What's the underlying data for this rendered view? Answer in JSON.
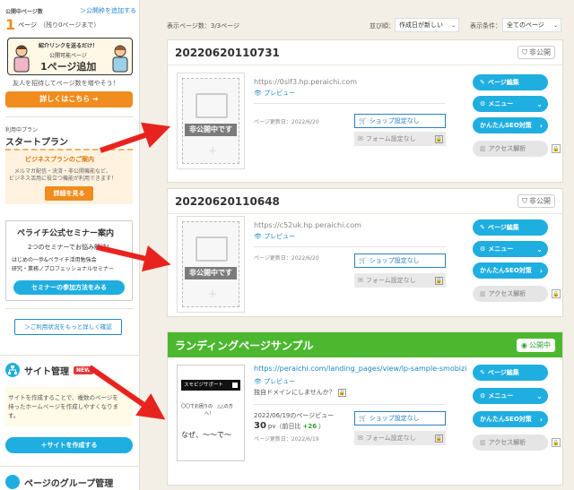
{
  "sidebar": {
    "public_pages_label": "公開中ページ数",
    "add_pages_link": "＞公開枠を追加する",
    "page_count": "1",
    "page_count_suffix": "ページ",
    "page_count_remaining": "（残り0ページまで）",
    "promo_top": "紹介リンクを送るだけ！",
    "promo_mid": "公開可能ページ",
    "promo_main": "1ページ追加",
    "promo_desc": "友人を招待してページ数を増やそう！",
    "promo_button": "詳しくはこちら",
    "plan_label": "利用中プラン",
    "plan_name": "スタートプラン",
    "business_title": "ビジネスプランのご案内",
    "business_desc1": "メルマガ配信・決済・非公開機能など、",
    "business_desc2": "ビジネス活用に役立つ機能が利用できます！",
    "business_button": "詳細を見る",
    "seminar_title": "ペライチ公式セミナー案内",
    "seminar_desc1": "2つのセミナーでお悩み解決!",
    "seminar_desc2": "はじめの一歩&ペライチ活用勉強会",
    "seminar_desc3": "研究・業務ノプロフェッショナルセミナー",
    "seminar_button": "セミナーの参加方法をみる",
    "usage_link": "＞ご利用状況をもっと詳しく確認",
    "site_title": "サイト管理",
    "site_badge": "NEW",
    "site_desc1": "サイトを作成することで、複数のページを",
    "site_desc2": "持ったホームページを作成しやすくなりま",
    "site_desc3": "す。",
    "site_button": "＋サイトを作成する",
    "group_title": "ページのグループ管理"
  },
  "toolbar": {
    "count_text": "表示ページ数：3/3ページ",
    "sort_label": "並び順：",
    "sort_value": "作成日が新しい",
    "filter_label": "表示条件：",
    "filter_value": "全てのページ"
  },
  "cards": [
    {
      "title": "20220620110731",
      "status": "非公開",
      "url": "https://0slf3.hp.peraichi.com",
      "preview": "プレビュー",
      "updated": "ページ更新日：2022/6/20",
      "thumb_label": "非公開中です"
    },
    {
      "title": "20220620110648",
      "status": "非公開",
      "url": "https://c52uk.hp.peraichi.com",
      "preview": "プレビュー",
      "updated": "ページ更新日：2022/6/20",
      "thumb_label": "非公開中です"
    },
    {
      "title": "ランディングページサンプル",
      "status": "公開中",
      "url": "https://peraichi.com/landing_pages/view/lp-sample-smobizi",
      "preview": "プレビュー",
      "domain_note": "独自ドメインにしませんか？",
      "date_pv": "2022/06/19のページビュー",
      "pv": "30",
      "pv_unit": "pv（前日比",
      "pv_diff": "+26",
      "pv_close": "）",
      "updated": "ページ更新日：2022/6/19",
      "thumb_header": "スモビジサポート",
      "thumb_line1": "〇〇でお困りの　△△の方",
      "thumb_line2": "へ！",
      "thumb_line3": "なぜ、〜〜で〜"
    }
  ],
  "actions": {
    "edit": "ページ編集",
    "menu": "メニュー",
    "seo": "かんたんSEO対策",
    "analytics": "アクセス解析",
    "shop": "ショップ設定なし",
    "form": "フォーム設定なし"
  },
  "colors": {
    "accent_blue": "#1faee0",
    "accent_orange": "#f08d1e",
    "green_header": "#4cb830",
    "arrow_red": "#e8231f"
  }
}
